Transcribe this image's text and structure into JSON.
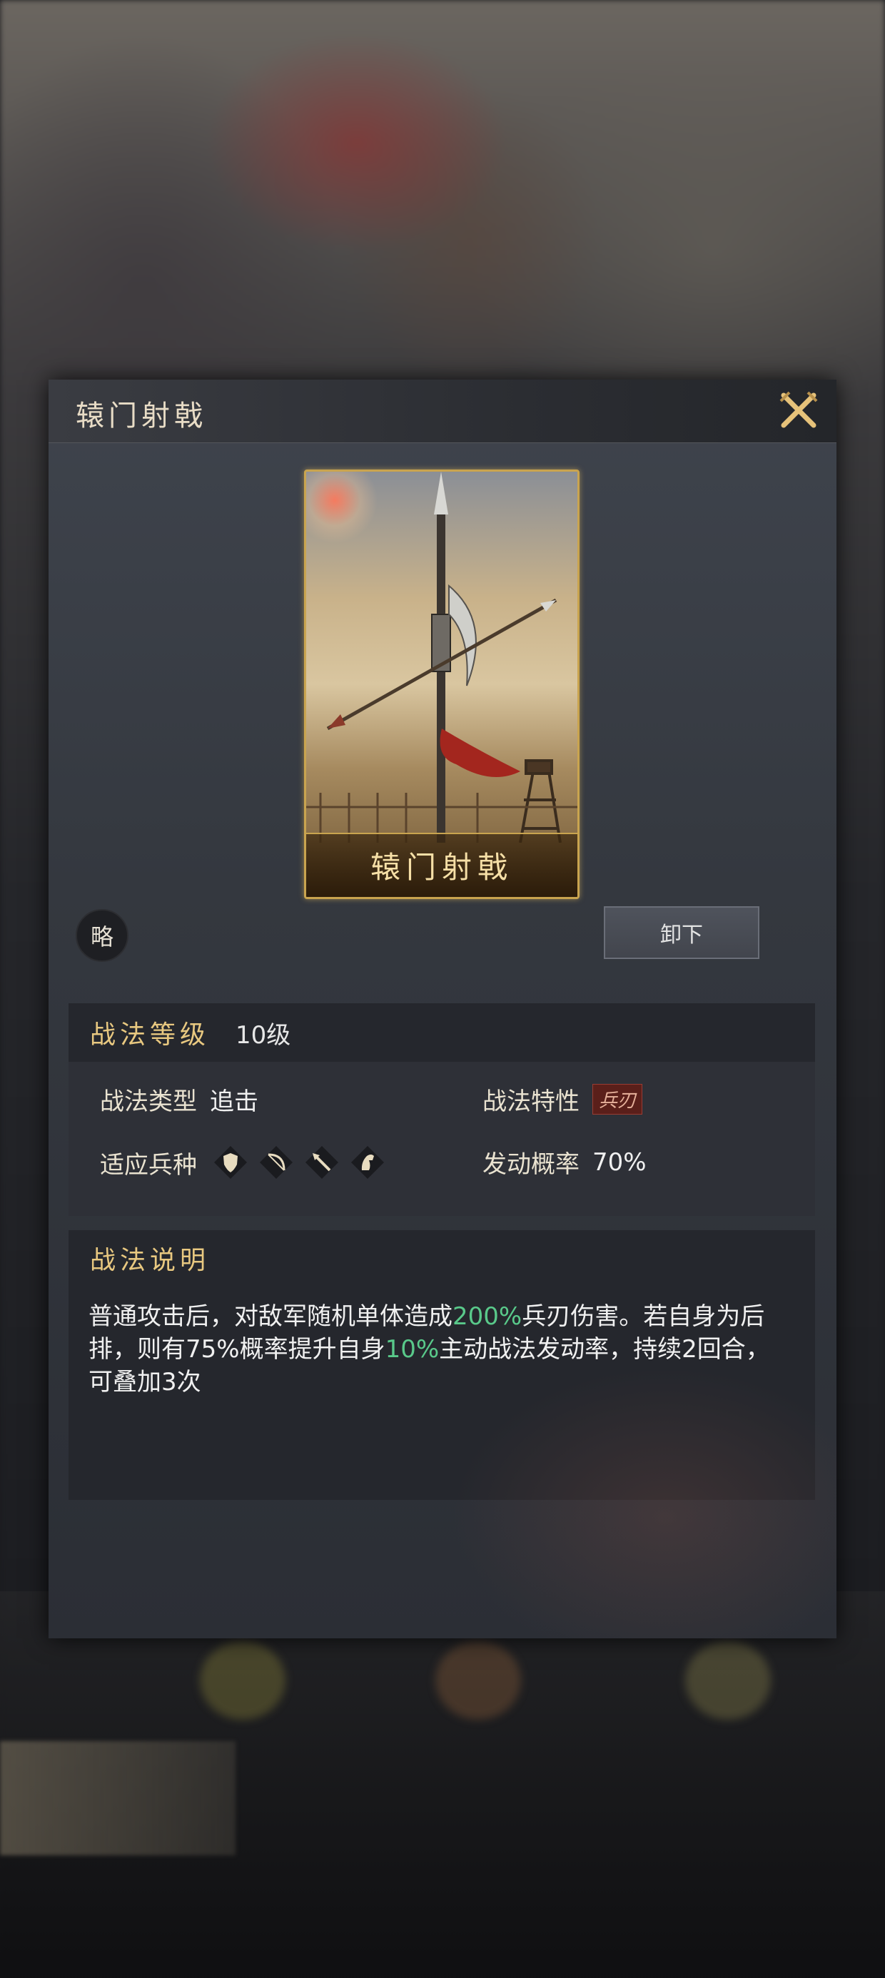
{
  "dialog": {
    "title": "辕门射戟",
    "card_name": "辕门射戟",
    "badge": "略",
    "unequip_label": "卸下"
  },
  "level_section": {
    "title": "战法等级",
    "value": "10级"
  },
  "attributes": {
    "type_label": "战法类型",
    "type_value": "追击",
    "trait_label": "战法特性",
    "trait_tag": "兵刃",
    "troop_label": "适应兵种",
    "troop_icons": [
      "shield-icon",
      "bow-icon",
      "spear-icon",
      "horse-icon"
    ],
    "rate_label": "发动概率",
    "rate_value": "70%"
  },
  "description": {
    "title": "战法说明",
    "part1": "普通攻击后，对敌军随机单体造成",
    "highlight1": "200%",
    "part2": "兵刃伤害。若自身为后排，则有75%概率提升自身",
    "highlight2": "10%",
    "part3": "主动战法发动率，持续2回合，可叠加3次"
  },
  "colors": {
    "gold_title": "#e8c880",
    "highlight": "#59c98a",
    "trait_tag_bg": "#5a1f1a"
  }
}
